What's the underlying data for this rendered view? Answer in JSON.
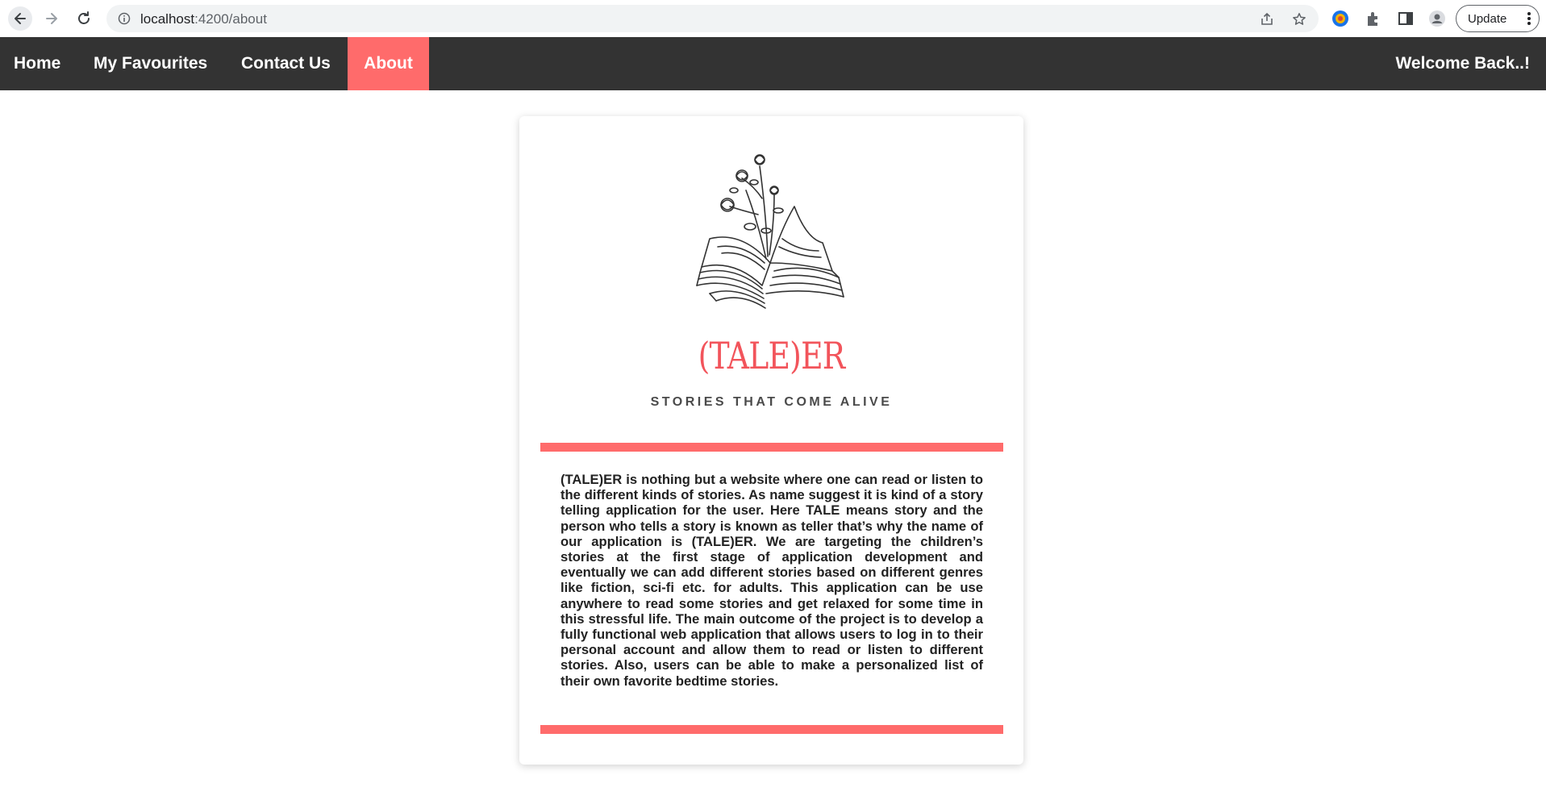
{
  "browser": {
    "url_host": "localhost",
    "url_path": ":4200/about",
    "update_label": "Update"
  },
  "navbar": {
    "items": [
      {
        "label": "Home"
      },
      {
        "label": "My Favourites"
      },
      {
        "label": "Contact Us"
      },
      {
        "label": "About",
        "active": true
      }
    ],
    "welcome": "Welcome Back..!",
    "active_color": "#ff6b6b",
    "background_color": "#333333"
  },
  "about": {
    "brand_name": "(TALE)ER",
    "tagline": "STORIES THAT COME ALIVE",
    "description": "(TALE)ER is nothing but a website where one can read or listen to the different kinds of stories. As name suggest it is kind of a story telling application for the user. Here TALE means story and the person who tells a story is known as teller that’s why the name of our application is (TALE)ER. We are targeting the children’s stories at the first stage of application development and eventually we can add different stories based on different genres like fiction, sci-fi etc. for adults. This application can be use anywhere to read some stories and get relaxed for some time in this stressful life. The main outcome of the project is to develop a fully functional web application that allows users to log in to their personal account and allow them to read or listen to different stories. Also, users can be able to make a personalized list of their own favorite bedtime stories.",
    "accent_color": "#ff6b6b",
    "logo_icon": "open-book-with-flowers-icon"
  }
}
